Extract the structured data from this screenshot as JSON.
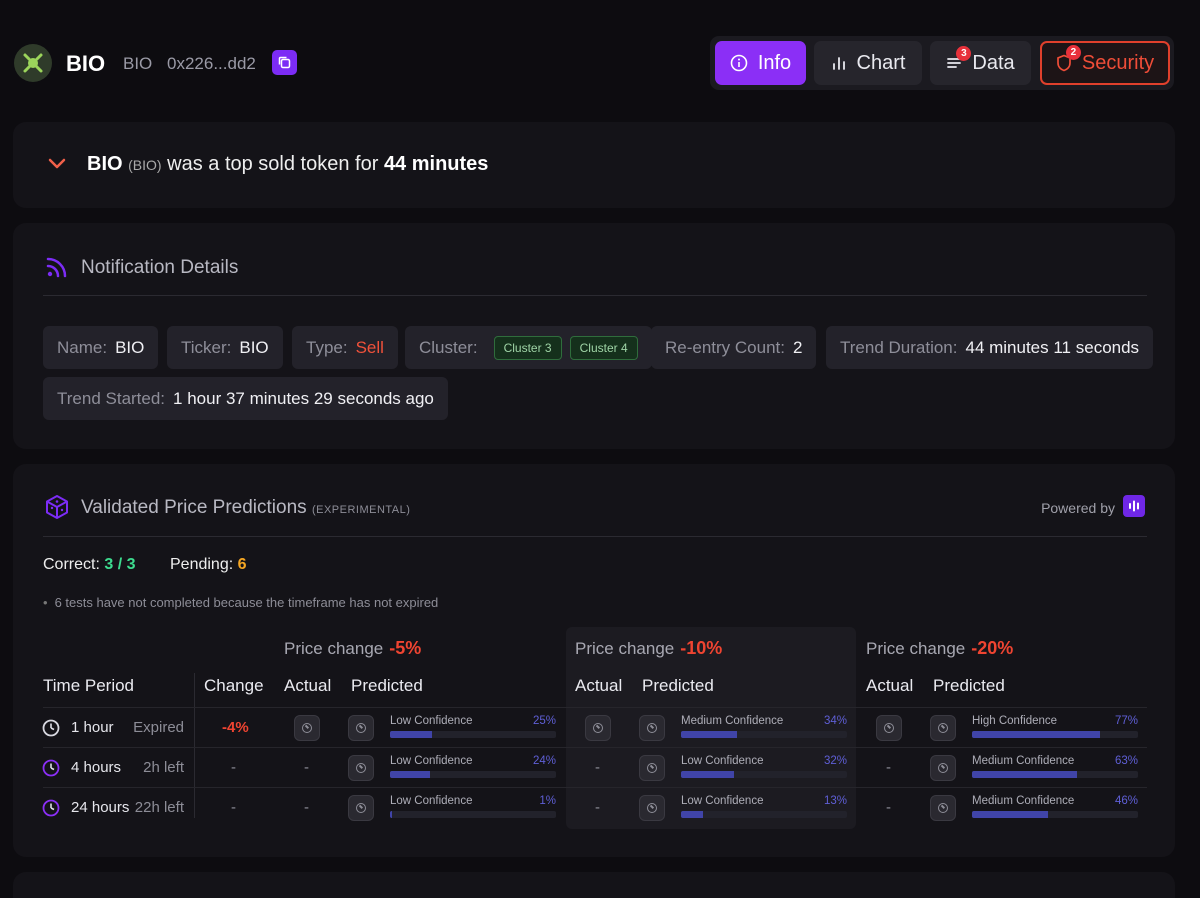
{
  "header": {
    "name": "BIO",
    "symbol": "BIO",
    "address": "0x226...dd2",
    "tabs": [
      {
        "label": "Info",
        "icon": "info-icon",
        "badge": ""
      },
      {
        "label": "Chart",
        "icon": "bar-chart-icon",
        "badge": ""
      },
      {
        "label": "Data",
        "icon": "list-icon",
        "badge": "3"
      },
      {
        "label": "Security",
        "icon": "shield-icon",
        "badge": "2"
      }
    ]
  },
  "banner": {
    "name": "BIO",
    "ticker": "(BIO)",
    "text": "was a top sold token for",
    "duration": "44 minutes"
  },
  "notification": {
    "title": "Notification Details",
    "chips": {
      "name": {
        "key": "Name:",
        "value": "BIO"
      },
      "ticker": {
        "key": "Ticker:",
        "value": "BIO"
      },
      "type": {
        "key": "Type:",
        "value": "Sell"
      },
      "cluster": {
        "key": "Cluster:",
        "values": [
          "Cluster 3",
          "Cluster 4"
        ]
      },
      "reentry": {
        "key": "Re-entry Count:",
        "value": "2"
      },
      "trend_duration": {
        "key": "Trend Duration:",
        "value": "44 minutes 11 seconds"
      },
      "trend_started": {
        "key": "Trend Started:",
        "value": "1 hour 37 minutes 29 seconds ago"
      }
    }
  },
  "predictions": {
    "title": "Validated Price Predictions",
    "subtitle": "(EXPERIMENTAL)",
    "powered_by": "Powered by",
    "correct_label": "Correct:",
    "correct_value": "3 / 3",
    "pending_label": "Pending:",
    "pending_value": "6",
    "note": "6 tests have not completed because the timeframe has not expired",
    "price_change_label": "Price change",
    "groups": [
      "-5%",
      "-10%",
      "-20%"
    ],
    "headers": {
      "time_period": "Time Period",
      "change": "Change",
      "actual": "Actual",
      "predicted": "Predicted"
    },
    "rows": [
      {
        "period": "1 hour",
        "status": "Expired",
        "change": "-4%",
        "groups": [
          {
            "actual": "",
            "confidence": "Low Confidence",
            "pct": "25%",
            "fraction": 0.25
          },
          {
            "actual": "",
            "confidence": "Medium Confidence",
            "pct": "34%",
            "fraction": 0.34
          },
          {
            "actual": "",
            "confidence": "High Confidence",
            "pct": "77%",
            "fraction": 0.77
          }
        ]
      },
      {
        "period": "4 hours",
        "status": "2h left",
        "change": "-",
        "groups": [
          {
            "actual": "-",
            "confidence": "Low Confidence",
            "pct": "24%",
            "fraction": 0.24
          },
          {
            "actual": "-",
            "confidence": "Low Confidence",
            "pct": "32%",
            "fraction": 0.32
          },
          {
            "actual": "-",
            "confidence": "Medium Confidence",
            "pct": "63%",
            "fraction": 0.63
          }
        ]
      },
      {
        "period": "24 hours",
        "status": "22h left",
        "change": "-",
        "groups": [
          {
            "actual": "-",
            "confidence": "Low Confidence",
            "pct": "1%",
            "fraction": 0.01
          },
          {
            "actual": "-",
            "confidence": "Low Confidence",
            "pct": "13%",
            "fraction": 0.13
          },
          {
            "actual": "-",
            "confidence": "Medium Confidence",
            "pct": "46%",
            "fraction": 0.46
          }
        ]
      }
    ]
  },
  "colors": {
    "accent": "#8b2ff6",
    "danger": "#ef4431",
    "success": "#3ddc8f",
    "pending": "#f5a623",
    "bar": "#4044a8"
  }
}
